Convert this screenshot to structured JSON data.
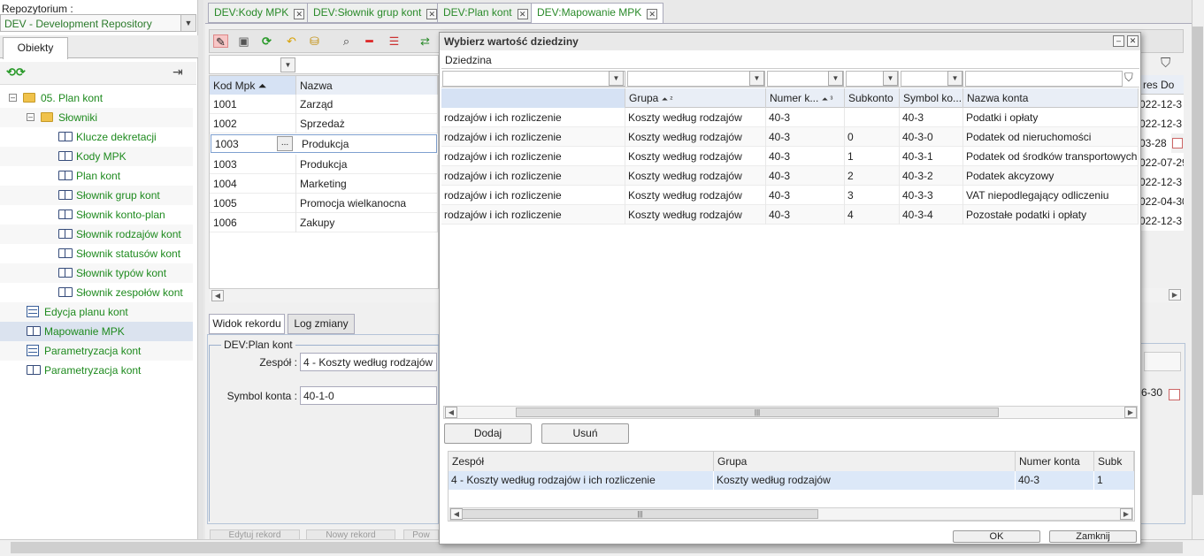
{
  "repo": {
    "label": "Repozytorium :",
    "value": "DEV - Development Repository"
  },
  "left_tab": "Obiekty",
  "tree": [
    {
      "label": "05. Plan kont",
      "icon": "folder-icon",
      "level": 0,
      "toggle": "⊟"
    },
    {
      "label": "Słowniki",
      "icon": "folder-icon",
      "level": 1,
      "toggle": "⊟"
    },
    {
      "label": "Klucze dekretacji",
      "icon": "book-icon",
      "level": 2
    },
    {
      "label": "Kody MPK",
      "icon": "book-icon",
      "level": 2
    },
    {
      "label": "Plan kont",
      "icon": "book-icon",
      "level": 2
    },
    {
      "label": "Słownik grup kont",
      "icon": "book-icon",
      "level": 2
    },
    {
      "label": "Słownik konto-plan",
      "icon": "book-icon",
      "level": 2
    },
    {
      "label": "Słownik rodzajów kont",
      "icon": "book-icon",
      "level": 2
    },
    {
      "label": "Słownik statusów kont",
      "icon": "book-icon",
      "level": 2
    },
    {
      "label": "Słownik typów kont",
      "icon": "book-icon",
      "level": 2
    },
    {
      "label": "Słownik zespołów kont",
      "icon": "book-icon",
      "level": 2
    },
    {
      "label": "Edycja planu kont",
      "icon": "form-icon",
      "level": 1
    },
    {
      "label": "Mapowanie MPK",
      "icon": "book-icon",
      "level": 1,
      "selected": true
    },
    {
      "label": "Parametryzacja kont",
      "icon": "form-icon",
      "level": 1
    },
    {
      "label": "Parametryzacja kont",
      "icon": "book-icon",
      "level": 1
    }
  ],
  "tabs": [
    "DEV:Kody MPK",
    "DEV:Słownik grup kont",
    "DEV:Plan kont",
    "DEV:Mapowanie MPK"
  ],
  "grid": {
    "headers": [
      "Kod Mpk",
      "Nazwa"
    ],
    "sort_arrow": "⏶",
    "edit_row": {
      "code": "1003",
      "ellipsis": "...",
      "name": "Produkcja"
    },
    "rows": [
      [
        "1001",
        "Zarząd"
      ],
      [
        "1002",
        "Sprzedaż"
      ],
      [
        "1003",
        "Produkcja"
      ],
      [
        "1004",
        "Marketing"
      ],
      [
        "1005",
        "Promocja wielkanocna"
      ],
      [
        "1006",
        "Zakupy"
      ]
    ]
  },
  "bottom_tabs": [
    "Widok rekordu",
    "Log zmiany"
  ],
  "record": {
    "legend": "DEV:Plan kont",
    "zespol_label": "Zespół :",
    "zespol_value": "4 - Koszty według rodzajów ...",
    "symbol_label": "Symbol konta :",
    "symbol_value": "40-1-0"
  },
  "right_remnant": {
    "header": "res Do",
    "cells": [
      "022-12-3",
      "022-12-3",
      "03-28",
      "022-07-29",
      "022-12-3",
      "022-04-30",
      "022-12-3"
    ],
    "date": "6-30"
  },
  "bottom_buttons": [
    "Edytuj rekord",
    "Nowy rekord",
    "Pow"
  ],
  "dialog": {
    "title": "Wybierz wartość dziedziny",
    "field_label": "Dziedzina",
    "headers": [
      "",
      "Grupa",
      "Numer k...",
      "Subkonto",
      "Symbol ko...",
      "Nazwa konta"
    ],
    "grupa_sort": "⏶ ²",
    "numer_sort": "⏶ ³",
    "rows": [
      [
        "rodzajów i ich rozliczenie",
        "Koszty według rodzajów",
        "40-3",
        "",
        "40-3",
        "Podatki i opłaty"
      ],
      [
        "rodzajów i ich rozliczenie",
        "Koszty według rodzajów",
        "40-3",
        "0",
        "40-3-0",
        "Podatek od nieruchomości"
      ],
      [
        "rodzajów i ich rozliczenie",
        "Koszty według rodzajów",
        "40-3",
        "1",
        "40-3-1",
        "Podatek od środków transportowych"
      ],
      [
        "rodzajów i ich rozliczenie",
        "Koszty według rodzajów",
        "40-3",
        "2",
        "40-3-2",
        "Podatek akcyzowy"
      ],
      [
        "rodzajów i ich rozliczenie",
        "Koszty według rodzajów",
        "40-3",
        "3",
        "40-3-3",
        "VAT niepodlegający odliczeniu"
      ],
      [
        "rodzajów i ich rozliczenie",
        "Koszty według rodzajów",
        "40-3",
        "4",
        "40-3-4",
        "Pozostałe podatki i opłaty"
      ]
    ],
    "add_label": "Dodaj",
    "remove_label": "Usuń",
    "selected_headers": [
      "Zespół",
      "Grupa",
      "Numer konta",
      "Subk"
    ],
    "selected_row": [
      "4 - Koszty według rodzajów i ich rozliczenie",
      "Koszty według rodzajów",
      "40-3",
      "1"
    ],
    "ok_label": "OK",
    "close_label": "Zamknij"
  },
  "colors": {
    "accent_green": "#1e8a1e",
    "selection": "#dce8f8",
    "header": "#e9eef6"
  }
}
